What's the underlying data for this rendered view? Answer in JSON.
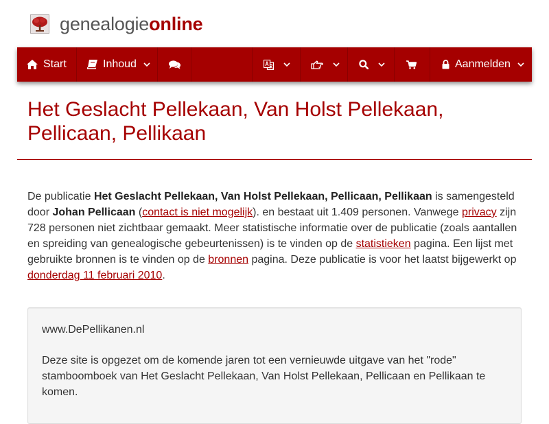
{
  "brand": {
    "part1": "genealogie",
    "part2": "online"
  },
  "nav": {
    "start": "Start",
    "inhoud": "Inhoud",
    "aanmelden": "Aanmelden"
  },
  "page": {
    "title_line1": "Het Geslacht Pellekaan, Van Holst Pellekaan,",
    "title_line2": "Pellicaan, Pellikaan"
  },
  "intro": {
    "t1": "De publicatie ",
    "pub": "Het Geslacht Pellekaan, Van Holst Pellekaan, Pellicaan, Pellikaan",
    "t2": " is samengesteld door ",
    "author": "Johan Pellicaan",
    "t3": " (",
    "contact_link": "contact is niet mogelijk",
    "t4": "). en bestaat uit 1.409 personen. Vanwege ",
    "privacy_link": "privacy",
    "t5": " zijn 728 personen niet zichtbaar gemaakt. Meer statistische informatie over de publicatie (zoals aantallen en spreiding van genealogische gebeurtenissen) is te vinden op de ",
    "stats_link": "statistieken",
    "t6": " pagina. Een lijst met gebruikte bronnen is te vinden op de ",
    "sources_link": "bronnen",
    "t7": " pagina. Deze publicatie is voor het laatst bijgewerkt op ",
    "date_link": "donderdag 11 februari 2010",
    "t8": "."
  },
  "card": {
    "title": "www.DePellikanen.nl",
    "text": "Deze site is opgezet om de komende jaren tot een vernieuwde uitgave van het \"rode\" stamboomboek van Het Geslacht Pellekaan, Van Holst Pellekaan, Pellicaan en Pellikaan te komen."
  },
  "colors": {
    "brand_red": "#a50000",
    "text": "#333333"
  },
  "icons": [
    "tree-logo-icon",
    "home-icon",
    "book-icon",
    "comments-icon",
    "translate-icon",
    "hand-point-icon",
    "search-icon",
    "cart-icon",
    "lock-icon",
    "chevron-down-icon"
  ]
}
